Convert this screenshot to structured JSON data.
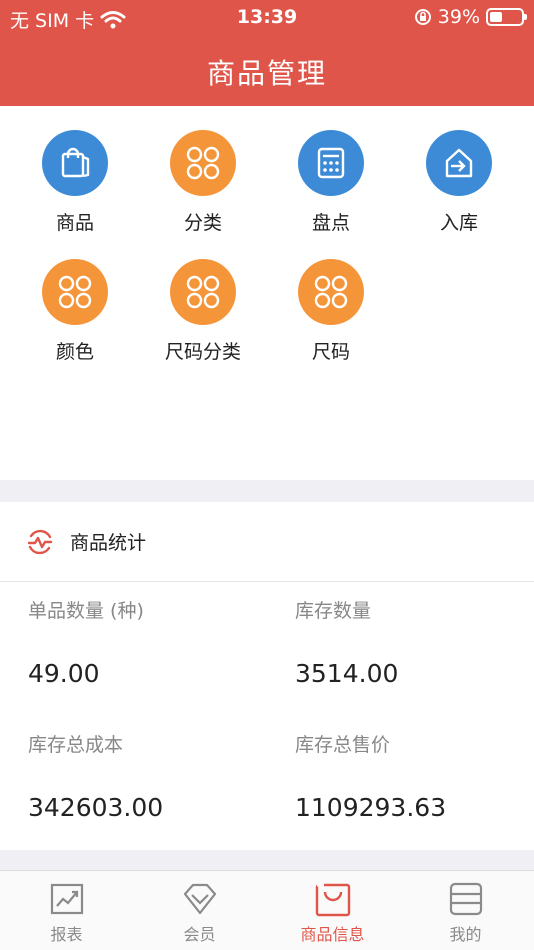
{
  "status_bar": {
    "carrier": "无 SIM 卡",
    "time": "13:39",
    "battery": "39%",
    "battery_level": 0.39
  },
  "header": {
    "title": "商品管理"
  },
  "colors": {
    "header": "#e0554a",
    "blue": "#3d8bd6",
    "orange": "#f5953a"
  },
  "grid": [
    {
      "label": "商品",
      "icon": "shopping-bag-icon",
      "color": "#3d8bd6"
    },
    {
      "label": "分类",
      "icon": "clover-icon",
      "color": "#f5953a"
    },
    {
      "label": "盘点",
      "icon": "calculator-icon",
      "color": "#3d8bd6"
    },
    {
      "label": "入库",
      "icon": "house-arrow-icon",
      "color": "#3d8bd6"
    },
    {
      "label": "颜色",
      "icon": "clover-icon",
      "color": "#f5953a"
    },
    {
      "label": "尺码分类",
      "icon": "clover-icon",
      "color": "#f5953a"
    },
    {
      "label": "尺码",
      "icon": "clover-icon",
      "color": "#f5953a"
    }
  ],
  "stats": {
    "title": "商品统计",
    "items": [
      {
        "label": "单品数量 (种)",
        "value": "49.00"
      },
      {
        "label": "库存数量",
        "value": "3514.00"
      },
      {
        "label": "库存总成本",
        "value": "342603.00"
      },
      {
        "label": "库存总售价",
        "value": "1109293.63"
      }
    ]
  },
  "tabs": [
    {
      "label": "报表",
      "icon": "report-icon",
      "active": false
    },
    {
      "label": "会员",
      "icon": "diamond-icon",
      "active": false
    },
    {
      "label": "商品信息",
      "icon": "bag-icon",
      "active": true
    },
    {
      "label": "我的",
      "icon": "profile-card-icon",
      "active": false
    }
  ]
}
